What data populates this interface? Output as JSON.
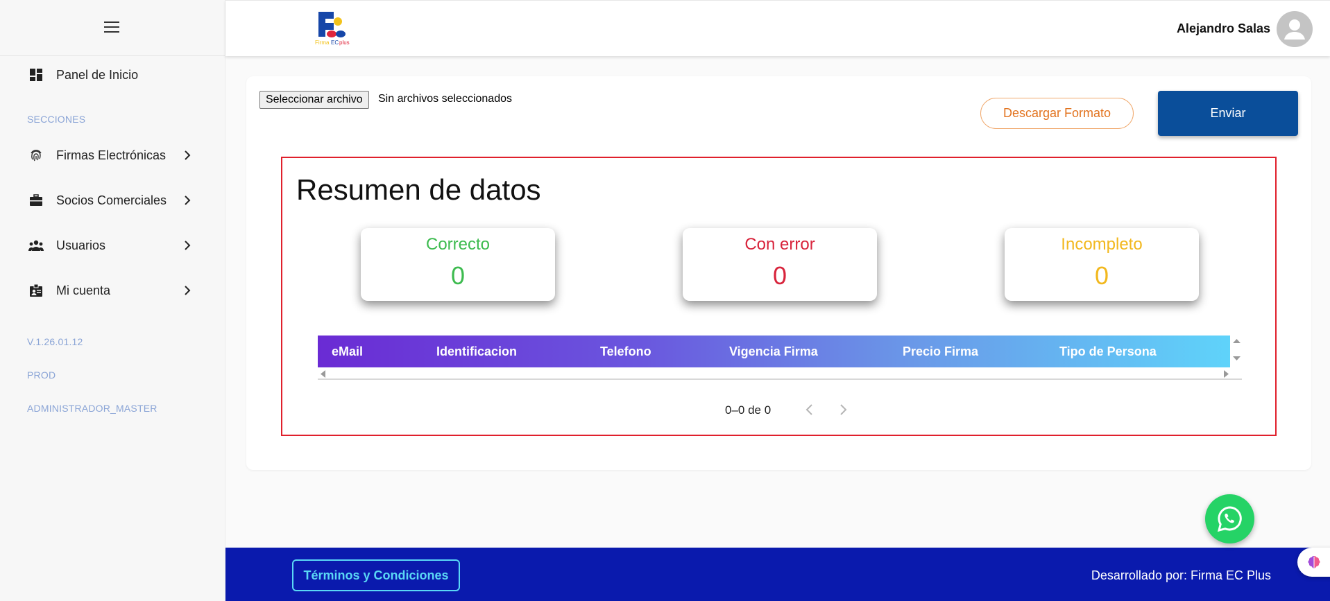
{
  "sidebar": {
    "items": [
      {
        "label": "Panel de Inicio",
        "icon": "dashboard-icon"
      },
      {
        "label": "Firmas Electrónicas",
        "icon": "fingerprint-icon"
      },
      {
        "label": "Socios Comerciales",
        "icon": "briefcase-icon"
      },
      {
        "label": "Usuarios",
        "icon": "users-icon"
      },
      {
        "label": "Mi cuenta",
        "icon": "id-badge-icon"
      }
    ],
    "section_label": "SECCIONES",
    "version": "V.1.26.01.12",
    "environment": "PROD",
    "role": "ADMINISTRADOR_MASTER"
  },
  "header": {
    "logo_text": "Firma EC plus",
    "user_name": "Alejandro Salas"
  },
  "upload": {
    "file_button_label": "Seleccionar archivo",
    "file_status": "Sin archivos seleccionados",
    "download_label": "Descargar Formato",
    "send_label": "Enviar"
  },
  "summary": {
    "title": "Resumen de datos",
    "stats": [
      {
        "label": "Correcto",
        "value": "0",
        "color": "#3dbb4f"
      },
      {
        "label": "Con error",
        "value": "0",
        "color": "#d8243c"
      },
      {
        "label": "Incompleto",
        "value": "0",
        "color": "#f2b81e"
      }
    ],
    "columns": [
      "eMail",
      "Identificacion",
      "Telefono",
      "Vigencia Firma",
      "Precio Firma",
      "Tipo de Persona"
    ],
    "pagination": "0–0 de 0"
  },
  "footer": {
    "terms_label": "Términos y Condiciones",
    "developer_text": "Desarrollado por: Firma EC Plus"
  }
}
